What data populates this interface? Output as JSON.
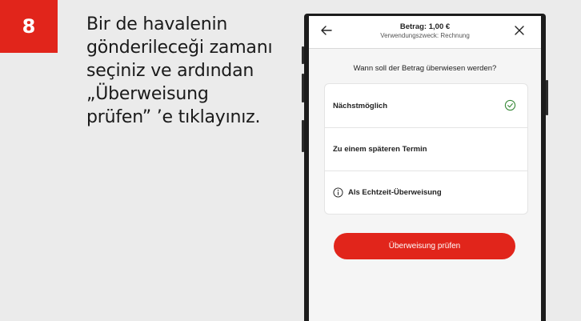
{
  "step": {
    "number": "8"
  },
  "instruction": {
    "lines": [
      "Bir de havalenin",
      "gönderileceği zamanı",
      "seçiniz ve ardından",
      "„Überweisung",
      "prüfen” ’e tıklayınız."
    ]
  },
  "app": {
    "header": {
      "amount": "Betrag: 1,00 €",
      "purpose": "Verwendungszweck: Rechnung",
      "back_icon": "arrow-left-icon",
      "close_icon": "close-icon"
    },
    "question": "Wann soll der Betrag überwiesen werden?",
    "options": [
      {
        "label": "Nächstmöglich",
        "selected": true
      },
      {
        "label": "Zu einem späteren Termin",
        "selected": false
      },
      {
        "label": "Als Echtzeit-Überweisung",
        "selected": false,
        "icon": "info-icon"
      }
    ],
    "primary_button": "Überweisung prüfen"
  },
  "colors": {
    "accent": "#e1251b",
    "check_green": "#3a8a3a",
    "background": "#ebebeb"
  }
}
